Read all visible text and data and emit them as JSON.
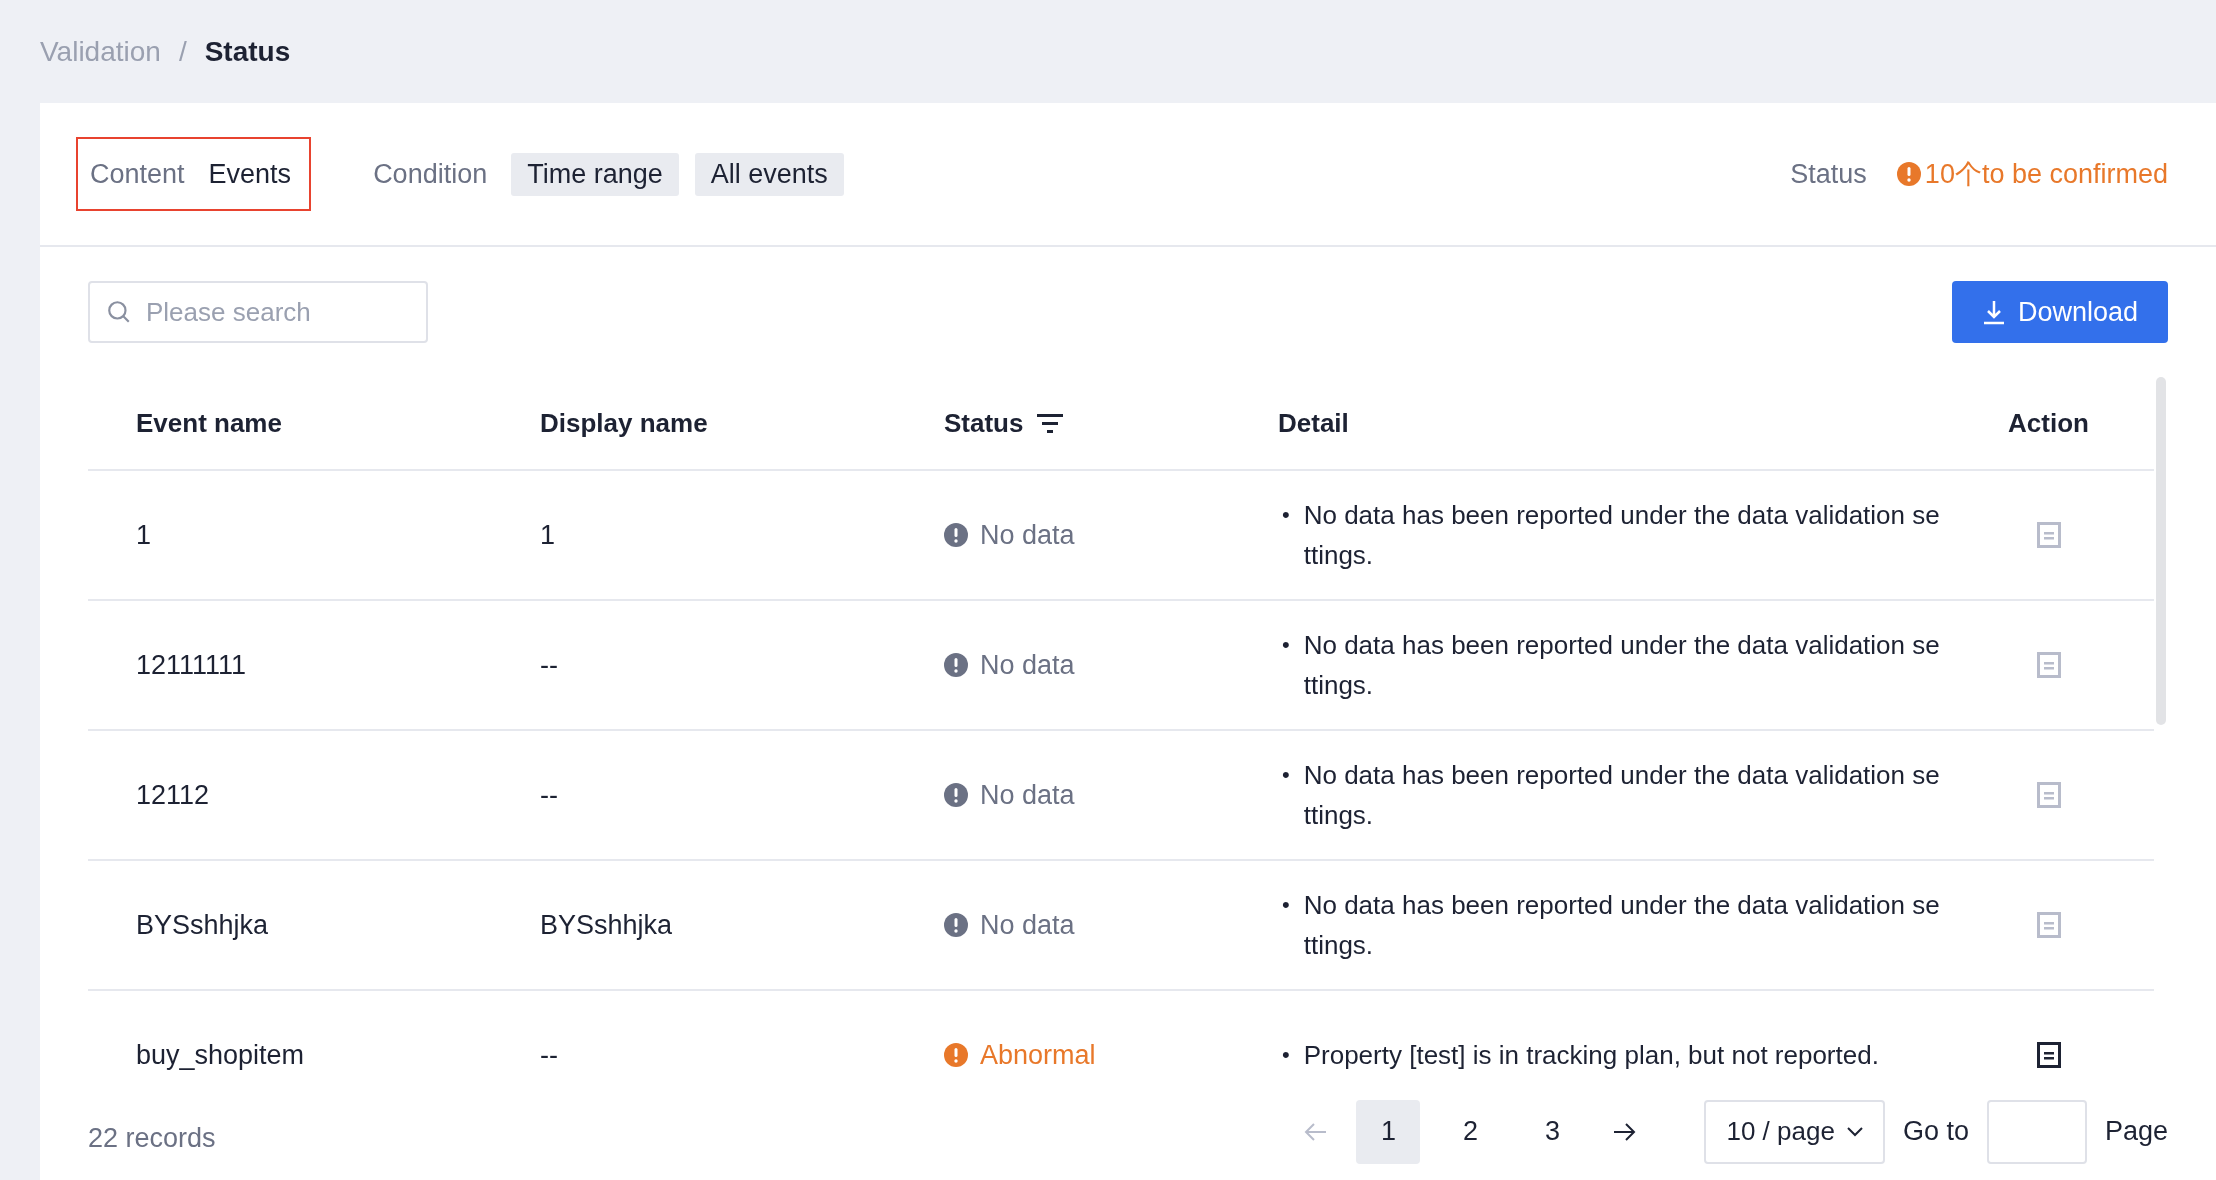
{
  "breadcrumb_separator": "/",
  "detail_bullet": "•",
  "breadcrumb": [
    {
      "label": "Validation",
      "current": false
    },
    {
      "label": "Status",
      "current": true
    }
  ],
  "view_tabs": [
    {
      "label": "Content",
      "selected": false
    },
    {
      "label": "Events",
      "selected": true
    }
  ],
  "filters": {
    "label": "Condition",
    "chips": [
      "Time range",
      "All events"
    ]
  },
  "status_summary": {
    "label": "Status",
    "warning": "10个to be confirmed"
  },
  "search": {
    "placeholder": "Please search"
  },
  "download_button": "Download",
  "table": {
    "columns": [
      "Event name",
      "Display name",
      "Status",
      "Detail",
      "Action"
    ],
    "rows": [
      {
        "event_name": "1",
        "display_name": "1",
        "status": {
          "kind": "no_data",
          "label": "No data"
        },
        "detail": "No data has been reported under the data validation se ttings."
      },
      {
        "event_name": "12111111",
        "display_name": "--",
        "status": {
          "kind": "no_data",
          "label": "No data"
        },
        "detail": "No data has been reported under the data validation se ttings."
      },
      {
        "event_name": "12112",
        "display_name": "--",
        "status": {
          "kind": "no_data",
          "label": "No data"
        },
        "detail": "No data has been reported under the data validation se ttings."
      },
      {
        "event_name": "BYSshhjka",
        "display_name": "BYSshhjka",
        "status": {
          "kind": "no_data",
          "label": "No data"
        },
        "detail": "No data has been reported under the data validation se ttings."
      },
      {
        "event_name": "buy_shopitem",
        "display_name": "--",
        "status": {
          "kind": "abnormal",
          "label": "Abnormal"
        },
        "detail": "Property [test] is in tracking plan, but not reported."
      }
    ]
  },
  "records": "22 records",
  "pagination": {
    "pages": [
      {
        "label": "1",
        "selected": true
      },
      {
        "label": "2",
        "selected": false
      },
      {
        "label": "3",
        "selected": false
      }
    ],
    "page_size": "10 / page",
    "goto_label": "Go to",
    "page_label": "Page"
  }
}
